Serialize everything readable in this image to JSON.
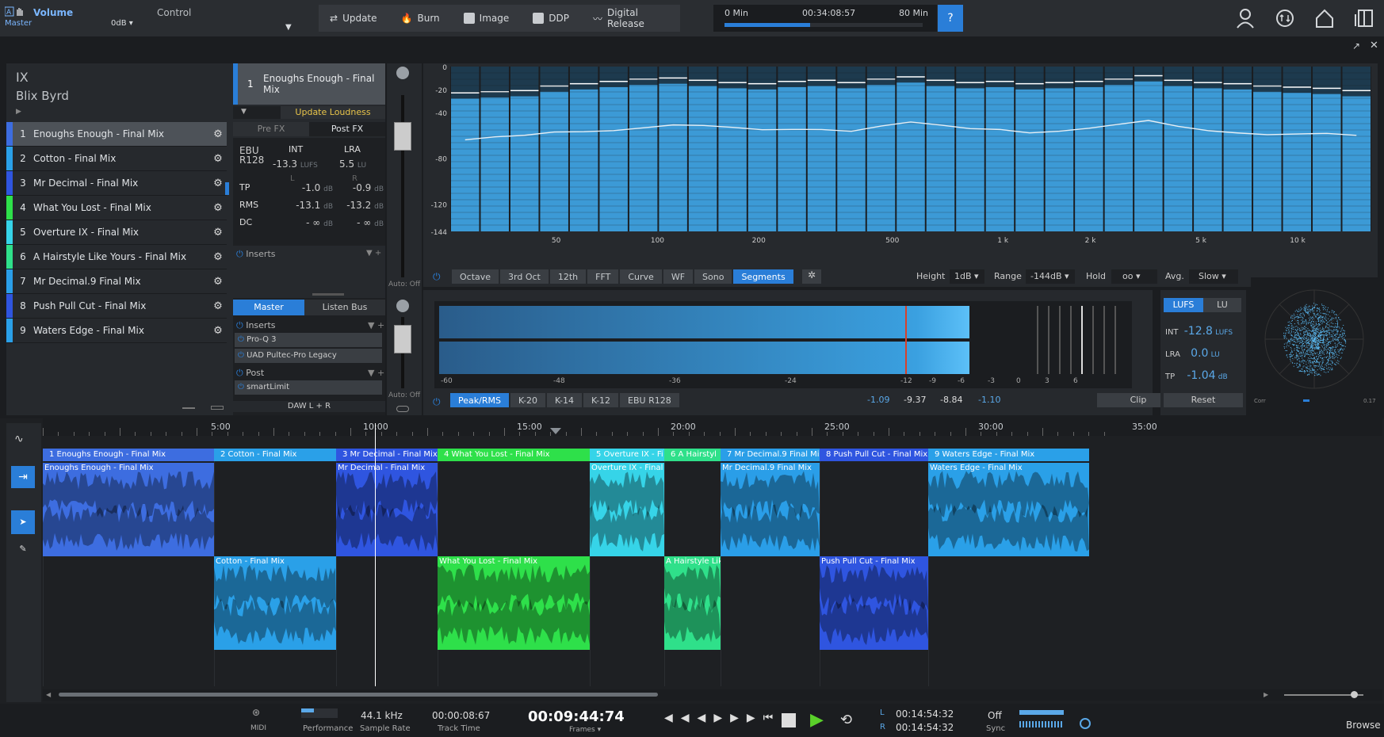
{
  "header": {
    "volume_label": "Volume",
    "control_label": "Control",
    "master_label": "Master",
    "db_value": "0dB",
    "buttons": [
      {
        "label": "Update",
        "icon": "update-icon"
      },
      {
        "label": "Burn",
        "icon": "burn-icon"
      },
      {
        "label": "Image",
        "icon": "image-icon"
      },
      {
        "label": "DDP",
        "icon": "ddp-icon"
      },
      {
        "label": "Digital Release",
        "icon": "waveform-icon"
      }
    ],
    "timeline": {
      "start": "0 Min",
      "current": "00:34:08:57",
      "end": "80 Min",
      "progress": 0.43
    },
    "help_label": "?"
  },
  "project": {
    "title": "IX",
    "artist": "Blix Byrd",
    "tracks": [
      {
        "num": "1",
        "name": "Enoughs Enough - Final Mix",
        "color": "#3d6de0"
      },
      {
        "num": "2",
        "name": "Cotton - Final Mix",
        "color": "#2aa0e8"
      },
      {
        "num": "3",
        "name": "Mr Decimal - Final Mix",
        "color": "#2f55e0"
      },
      {
        "num": "4",
        "name": "What You Lost - Final Mix",
        "color": "#2ee04a"
      },
      {
        "num": "5",
        "name": "Overture IX - Final Mix",
        "color": "#36d4e8"
      },
      {
        "num": "6",
        "name": "A Hairstyle Like Yours - Final Mix",
        "color": "#2fe08a"
      },
      {
        "num": "7",
        "name": "Mr Decimal.9 Final Mix",
        "color": "#2a9ee8"
      },
      {
        "num": "8",
        "name": "Push Pull Cut - Final Mix",
        "color": "#2f55e0"
      },
      {
        "num": "9",
        "name": "Waters Edge - Final Mix",
        "color": "#2aa0e8"
      }
    ]
  },
  "track_panel": {
    "num": "1",
    "title": "Enoughs Enough - Final Mix",
    "update_loudness": "Update Loudness",
    "pre_fx": "Pre FX",
    "post_fx": "Post FX",
    "ebu": "EBU R128",
    "int_label": "INT",
    "lra_label": "LRA",
    "int_val": "-13.3",
    "int_unit": "LUFS",
    "lra_val": "5.5",
    "lra_unit": "LU",
    "l_label": "L",
    "r_label": "R",
    "rows": [
      {
        "label": "TP",
        "l": "-1.0",
        "lu": "dB",
        "r": "-0.9",
        "ru": "dB"
      },
      {
        "label": "RMS",
        "l": "-13.1",
        "lu": "dB",
        "r": "-13.2",
        "ru": "dB"
      },
      {
        "label": "DC",
        "l": "- ∞",
        "lu": "dB",
        "r": "- ∞",
        "ru": "dB"
      }
    ],
    "inserts": "Inserts",
    "auto_off": "Auto: Off"
  },
  "master_panel": {
    "master_tab": "Master",
    "listen_tab": "Listen Bus",
    "inserts": "Inserts",
    "plugins": [
      "Pro-Q 3",
      "UAD Pultec-Pro Legacy"
    ],
    "post": "Post",
    "post_plugins": [
      "smartLimit"
    ],
    "output": "DAW L + R",
    "auto_off": "Auto: Off"
  },
  "spectrum": {
    "y_ticks": [
      "0",
      "-20",
      "-40",
      "-80",
      "-120",
      "-144"
    ],
    "x_ticks": [
      "50",
      "100",
      "200",
      "500",
      "1 k",
      "2 k",
      "5 k",
      "10 k"
    ],
    "modes": [
      "Octave",
      "3rd Oct",
      "12th",
      "FFT",
      "Curve",
      "WF",
      "Sono",
      "Segments"
    ],
    "active_mode": "Segments",
    "height_label": "Height",
    "height_val": "1dB",
    "range_label": "Range",
    "range_val": "-144dB",
    "hold_label": "Hold",
    "hold_val": "oo",
    "avg_label": "Avg.",
    "avg_val": "Slow",
    "bars": [
      -28,
      -27,
      -26,
      -22,
      -20,
      -18,
      -16,
      -15,
      -17,
      -19,
      -20,
      -18,
      -17,
      -19,
      -16,
      -14,
      -17,
      -19,
      -18,
      -20,
      -19,
      -18,
      -16,
      -13,
      -17,
      -19,
      -20,
      -22,
      -23,
      -24,
      -26
    ]
  },
  "meter": {
    "scale": [
      "-60",
      "-48",
      "-36",
      "-24",
      "-12",
      "-9",
      "-6",
      "-3",
      "0",
      "3",
      "6"
    ],
    "modes": [
      "Peak/RMS",
      "K-20",
      "K-14",
      "K-12",
      "EBU R128"
    ],
    "active_mode": "Peak/RMS",
    "readouts": [
      "-1.09",
      "-9.37",
      "-8.84",
      "-1.10"
    ],
    "clip": "Clip",
    "level": 0.89
  },
  "loudness": {
    "lufs_tab": "LUFS",
    "lu_tab": "LU",
    "int_label": "INT",
    "int_val": "-12.8",
    "int_unit": "LUFS",
    "lra_label": "LRA",
    "lra_val": "0.0",
    "lra_unit": "LU",
    "tp_label": "TP",
    "tp_val": "-1.04",
    "tp_unit": "dB",
    "reset": "Reset"
  },
  "scope": {
    "corr_label": "Corr",
    "corr_val": "0.17"
  },
  "ruler": {
    "ticks": [
      "5:00",
      "10:00",
      "15:00",
      "20:00",
      "25:00",
      "30:00",
      "35:00"
    ]
  },
  "arrange": {
    "track_labels": [
      "1  Enoughs Enough - Final Mix",
      "2  Cotton - Final Mix",
      "3  Mr Decimal - Final Mix",
      "4  What You Lost - Final Mix",
      "5  Overture IX - Fi",
      "6  A Hairstyl",
      "7  Mr Decimal.9 Final Mix",
      "8  Push Pull Cut - Final Mix",
      "9  Waters Edge - Final Mix"
    ],
    "clips": [
      "Enoughs Enough - Final Mix",
      "Cotton - Final Mix",
      "Mr Decimal - Final Mix",
      "What You Lost - Final Mix",
      "Overture IX - Final M",
      "A Hairstyle Like",
      "Mr Decimal.9 Final Mix",
      "Push Pull Cut - Final Mix",
      "Waters Edge - Final Mix"
    ]
  },
  "transport": {
    "midi": "MIDI",
    "performance": "Performance",
    "sample_rate": "44.1 kHz",
    "sample_rate_label": "Sample Rate",
    "track_time": "00:00:08:67",
    "track_time_label": "Track Time",
    "main_time": "00:09:44:74",
    "frames_label": "Frames",
    "l_label": "L",
    "r_label": "R",
    "l_time": "00:14:54:32",
    "r_time": "00:14:54:32",
    "sync_val": "Off",
    "sync_label": "Sync",
    "browse": "Browse"
  }
}
